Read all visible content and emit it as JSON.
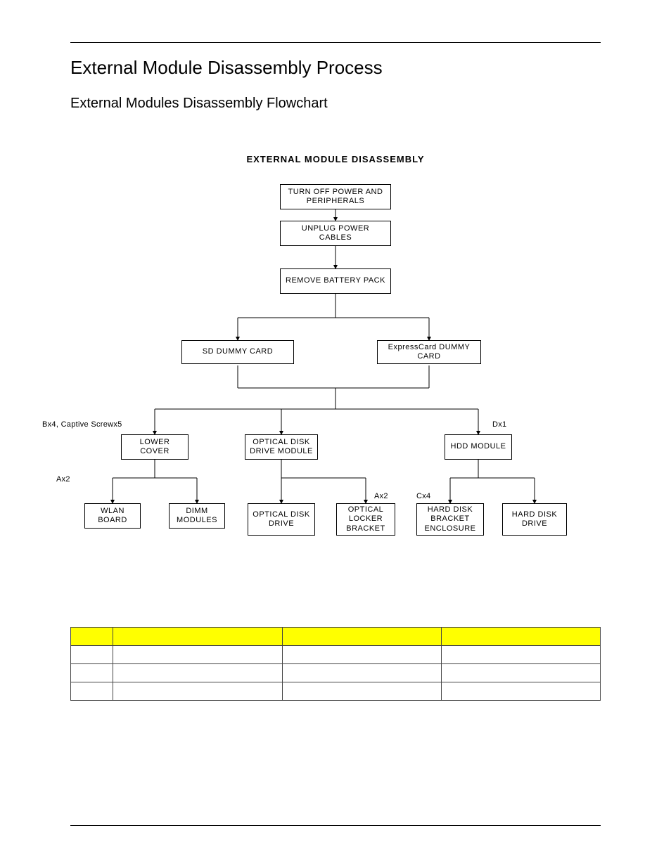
{
  "heading": "External Module Disassembly Process",
  "subheading": "External Modules Disassembly Flowchart",
  "chart_data": {
    "type": "flowchart",
    "title": "EXTERNAL MODULE DISASSEMBLY",
    "nodes": {
      "turn_off": "TURN OFF POWER AND PERIPHERALS",
      "unplug": "UNPLUG POWER CABLES",
      "battery": "REMOVE BATTERY PACK",
      "sd": "SD DUMMY CARD",
      "express": "ExpressCard DUMMY CARD",
      "lower_cover": "LOWER COVER",
      "odd_module": "OPTICAL DISK DRIVE MODULE",
      "hdd_module": "HDD MODULE",
      "wlan": "WLAN BOARD",
      "dimm": "DIMM MODULES",
      "odd": "OPTICAL DISK DRIVE",
      "olb": "OPTICAL LOCKER BRACKET",
      "hd_bracket": "HARD DISK BRACKET ENCLOSURE",
      "hd_drive": "HARD DISK DRIVE"
    },
    "labels": {
      "bx4": "Bx4, Captive Screwx5",
      "dx1": "Dx1",
      "ax2a": "Ax2",
      "ax2b": "Ax2",
      "cx4": "Cx4"
    },
    "edges": [
      [
        "turn_off",
        "unplug"
      ],
      [
        "unplug",
        "battery"
      ],
      [
        "battery",
        "sd"
      ],
      [
        "battery",
        "express"
      ],
      [
        "sd",
        "lower_cover"
      ],
      [
        "sd",
        "odd_module"
      ],
      [
        "express",
        "odd_module"
      ],
      [
        "express",
        "hdd_module"
      ],
      [
        "lower_cover",
        "wlan"
      ],
      [
        "lower_cover",
        "dimm"
      ],
      [
        "odd_module",
        "odd"
      ],
      [
        "odd_module",
        "olb"
      ],
      [
        "hdd_module",
        "hd_bracket"
      ],
      [
        "hdd_module",
        "hd_drive"
      ]
    ]
  },
  "table": {
    "headers": [
      "",
      "",
      "",
      ""
    ],
    "rows": [
      [
        "",
        "",
        "",
        ""
      ],
      [
        "",
        "",
        "",
        ""
      ],
      [
        "",
        "",
        "",
        ""
      ]
    ]
  }
}
